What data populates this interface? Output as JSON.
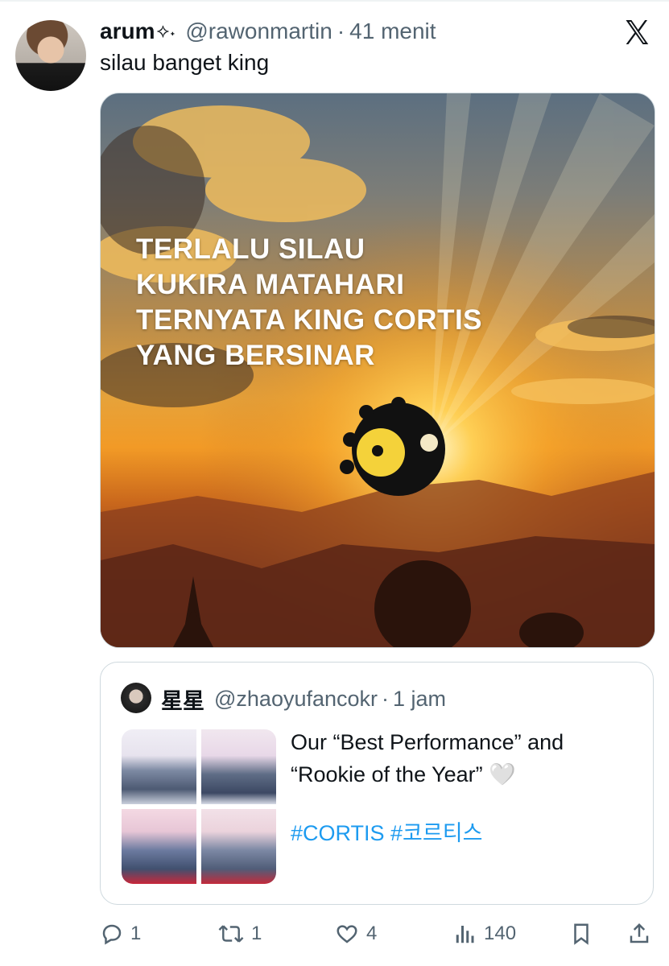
{
  "tweet": {
    "author_name": "arum",
    "author_emoji": "⟡˖",
    "handle": "@rawonmartin",
    "separator": "·",
    "time": "41 menit",
    "text": "silau banget king"
  },
  "media": {
    "overlay_lines": [
      "TERLALU SILAU",
      "KUKIRA MATAHARI",
      "TERNYATA KING CORTIS",
      "YANG BERSINAR"
    ]
  },
  "quote": {
    "author_name": "星星",
    "handle": "@zhaoyufancokr",
    "separator": "·",
    "time": "1 jam",
    "text_line1": "Our “Best Performance” and",
    "text_line2": "“Rookie of the Year” 🤍",
    "hashtags": "#CORTIS #코르티스"
  },
  "actions": {
    "replies": "1",
    "reposts": "1",
    "likes": "4",
    "views": "140"
  },
  "colors": {
    "text_primary": "#0f1419",
    "text_secondary": "#536471",
    "link": "#1d9bf0",
    "border": "#cfd9de"
  },
  "icons": [
    "x-logo-icon",
    "reply-icon",
    "repost-icon",
    "like-icon",
    "views-icon",
    "bookmark-icon",
    "share-icon"
  ]
}
